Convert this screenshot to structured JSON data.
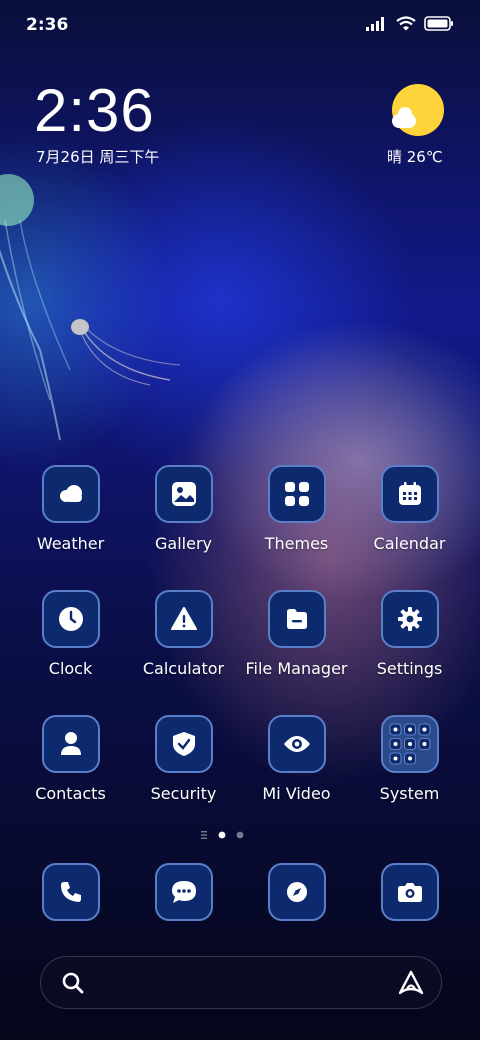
{
  "status_bar": {
    "time": "2:36"
  },
  "lockclock": {
    "time": "2:36",
    "date": "7月26日 周三下午"
  },
  "weather": {
    "text": "晴 26℃",
    "icon": "sunny-cloud-icon"
  },
  "colors": {
    "tile_bg": "#0d2a6e",
    "tile_border": "#5b7ec9",
    "sun": "#ffd43b"
  },
  "apps_row1": [
    {
      "label": "Weather",
      "icon": "weather-icon"
    },
    {
      "label": "Gallery",
      "icon": "gallery-icon"
    },
    {
      "label": "Themes",
      "icon": "themes-icon"
    },
    {
      "label": "Calendar",
      "icon": "calendar-icon"
    }
  ],
  "apps_row2": [
    {
      "label": "Clock",
      "icon": "clock-icon"
    },
    {
      "label": "Calculator",
      "icon": "calculator-icon"
    },
    {
      "label": "File Manager",
      "icon": "file-manager-icon"
    },
    {
      "label": "Settings",
      "icon": "gear-icon"
    }
  ],
  "apps_row3": [
    {
      "label": "Contacts",
      "icon": "contacts-icon"
    },
    {
      "label": "Security",
      "icon": "shield-icon"
    },
    {
      "label": "Mi Video",
      "icon": "eye-icon"
    },
    {
      "label": "System",
      "icon": "folder-icon"
    }
  ],
  "dock": [
    {
      "icon": "phone-icon"
    },
    {
      "icon": "messages-icon"
    },
    {
      "icon": "compass-icon"
    },
    {
      "icon": "camera-icon"
    }
  ],
  "page_indicator": {
    "current": 1,
    "total": 2
  }
}
